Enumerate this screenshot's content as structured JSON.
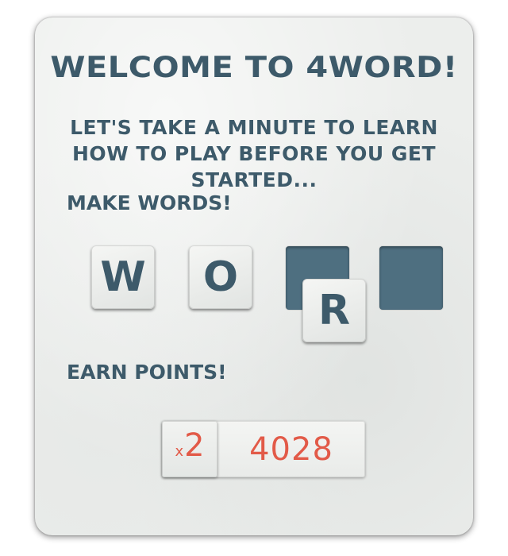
{
  "tutorial": {
    "title": "WELCOME TO 4WORD!",
    "intro": "LET'S TAKE A MINUTE TO LEARN HOW TO PLAY BEFORE YOU GET STARTED...",
    "make_words_label": "MAKE WORDS!",
    "earn_points_label": "EARN POINTS!"
  },
  "word_tiles": [
    {
      "letter": "W",
      "state": "placed"
    },
    {
      "letter": "O",
      "state": "placed"
    },
    {
      "letter": "R",
      "state": "dragging"
    }
  ],
  "empty_slots": 2,
  "score": {
    "multiplier_prefix": "x",
    "multiplier_value": "2",
    "points": "4028"
  },
  "colors": {
    "text": "#3d5a6a",
    "slot": "#4e6f80",
    "score": "#e25a48",
    "card": "#eceeec"
  }
}
